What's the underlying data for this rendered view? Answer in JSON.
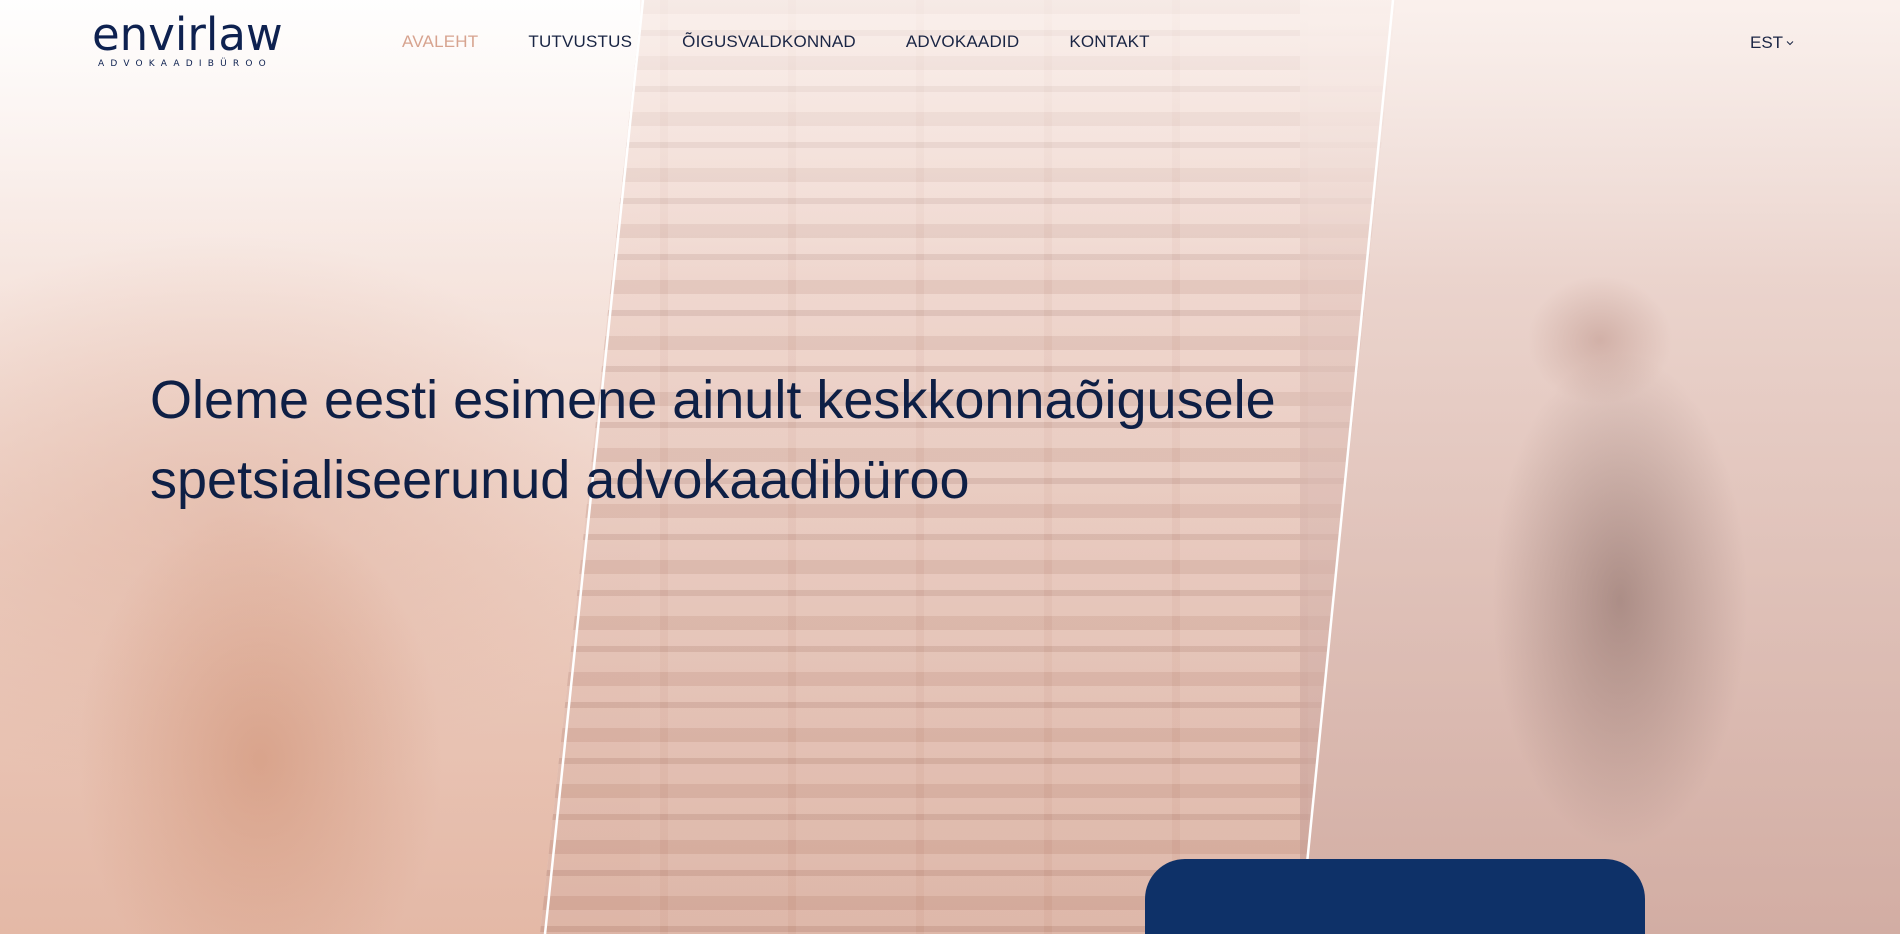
{
  "brand": {
    "name": "envirlaw",
    "tagline": "ADVOKAADIBÜROO",
    "primary_color": "#0e2150",
    "accent_color": "#d7a38f",
    "card_color": "#0e3168"
  },
  "nav": {
    "items": [
      {
        "label": "AVALEHT",
        "active": true
      },
      {
        "label": "TUTVUSTUS",
        "active": false
      },
      {
        "label": "ÕIGUSVALDKONNAD",
        "active": false
      },
      {
        "label": "ADVOKAADID",
        "active": false
      },
      {
        "label": "KONTAKT",
        "active": false
      }
    ]
  },
  "language": {
    "selected": "EST",
    "icon": "chevron-down-icon"
  },
  "hero": {
    "headline_line1": "Oleme eesti esimene ainult keskkonnaõigusele",
    "headline_line2": "spetsialiseerunud advokaadibüroo",
    "images": [
      "deer-photo",
      "railway-freight-photo",
      "fisherman-photo"
    ]
  }
}
